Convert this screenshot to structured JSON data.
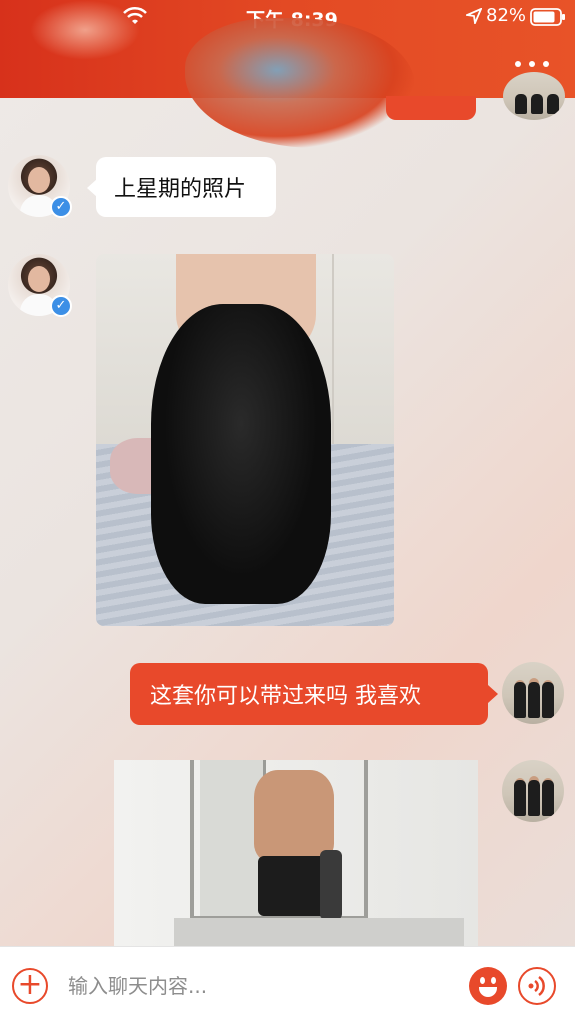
{
  "status_bar": {
    "time": "下午 8:39",
    "battery_percent": "82%",
    "battery_level": 0.82
  },
  "header": {
    "more_icon": "more-horizontal-icon"
  },
  "messages": [
    {
      "from": "other",
      "type": "text",
      "text": "上星期的照片"
    },
    {
      "from": "other",
      "type": "image"
    },
    {
      "from": "me",
      "type": "text",
      "text": "这套你可以带过来吗 我喜欢"
    },
    {
      "from": "me",
      "type": "image"
    }
  ],
  "input_bar": {
    "placeholder": "输入聊天内容...",
    "plus_icon": "plus-icon",
    "emoji_icon": "emoji-icon",
    "voice_icon": "voice-icon"
  },
  "colors": {
    "accent": "#e8492b",
    "header": "#d7311b",
    "verified": "#3c8fe6"
  }
}
